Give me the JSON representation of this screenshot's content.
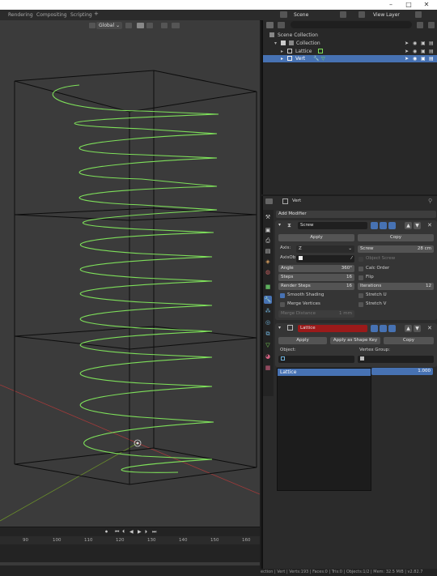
{
  "window": {
    "minimize": "–",
    "maximize": "□",
    "close": "✕"
  },
  "topbar": {
    "workspaces": [
      "Rendering",
      "Compositing",
      "Scripting"
    ],
    "add_workspace": "+",
    "scene": "Scene",
    "view_layer": "View Layer"
  },
  "viewport": {
    "orientation": "Global",
    "orientation_chevron": "⌄"
  },
  "timeline": {
    "frames": [
      "90",
      "100",
      "110",
      "120",
      "130",
      "140",
      "150",
      "160"
    ],
    "controls": [
      "⏺",
      "⏮",
      "⏴",
      "◀",
      "▶",
      "⏵",
      "⏭"
    ]
  },
  "outliner": {
    "search_placeholder": "",
    "scene_collection": "Scene Collection",
    "items": [
      {
        "name": "Collection",
        "indent": 1,
        "selected": false
      },
      {
        "name": "Lattice",
        "indent": 2,
        "selected": false
      },
      {
        "name": "Vert",
        "indent": 2,
        "selected": true
      }
    ]
  },
  "properties": {
    "object_name": "Vert",
    "add_modifier": "Add Modifier",
    "screw": {
      "name": "Screw",
      "apply": "Apply",
      "copy": "Copy",
      "axis_label": "Axis:",
      "axis_value": "Z",
      "axisob_label": "AxisOb",
      "screw_label": "Screw",
      "screw_value": "28 cm",
      "object_screw": "Object Screw",
      "angle_label": "Angle",
      "angle_value": "360°",
      "calc_order": "Calc Order",
      "steps_label": "Steps",
      "steps_value": "16",
      "flip": "Flip",
      "render_steps_label": "Render Steps",
      "render_steps_value": "16",
      "iterations_label": "Iterations",
      "iterations_value": "12",
      "smooth_shading": "Smooth Shading",
      "stretch_u": "Stretch U",
      "merge_vertices": "Merge Vertices",
      "stretch_v": "Stretch V",
      "merge_distance_label": "Merge Distance",
      "merge_distance_value": "1 mm"
    },
    "lattice": {
      "name": "Lattice",
      "apply": "Apply",
      "apply_shape_key": "Apply as Shape Key",
      "copy": "Copy",
      "object_label": "Object:",
      "vertex_group_label": "Vertex Group:",
      "object_value": "",
      "vertex_group_value": "",
      "list_item": "Lattice",
      "strength": "1.000"
    }
  },
  "statusbar": {
    "text": "ection | Vert | Verts:193 | Faces:0 | Tris:0 | Objects:1/2 | Mem: 32.5 MiB | v2.82.7"
  },
  "colors": {
    "viewport_bg": "#3b3b3b",
    "helix": "#7ee05a",
    "selected_blue": "#4772b3",
    "lattice_name_red": "#9b1a1a",
    "axis_red": "#a33a3a",
    "axis_green": "#6a8f2a"
  },
  "icons": {
    "mode": "view-icon",
    "scene": "scene-icon",
    "view_layer": "view-layer-icon",
    "wrench": "wrench-icon",
    "lattice": "lattice-icon",
    "screw": "screw-icon",
    "eye": "eye-icon",
    "camera": "camera-icon",
    "pin": "pin-icon",
    "close": "close-icon"
  }
}
